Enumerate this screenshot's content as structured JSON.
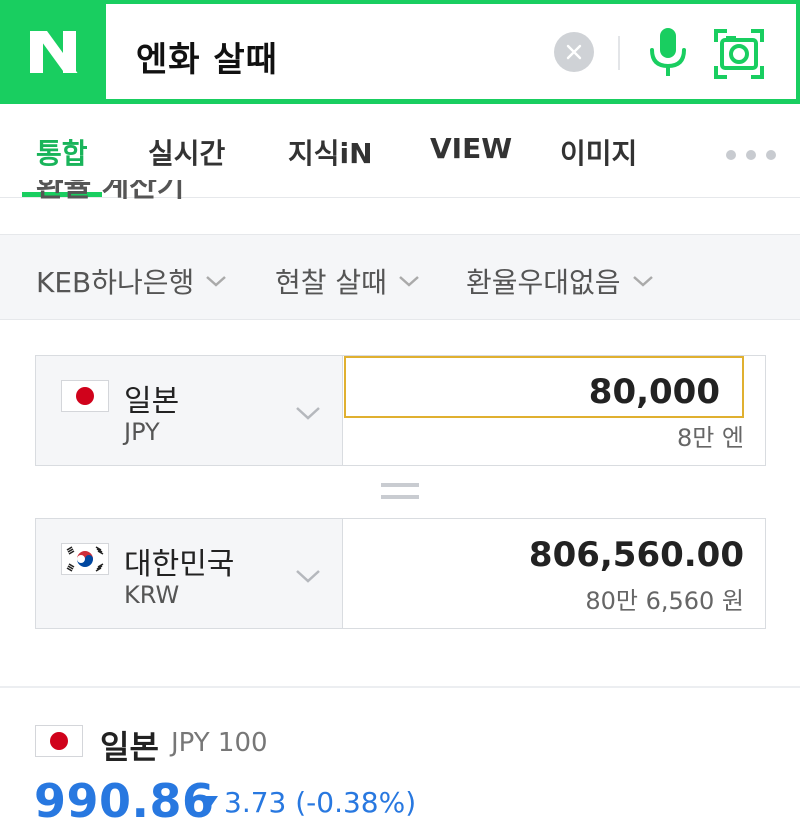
{
  "header": {
    "logo_letter": "N",
    "search_query": "엔화 살때"
  },
  "tabs": [
    {
      "label": "통합",
      "active": true
    },
    {
      "label": "실시간",
      "active": false
    },
    {
      "label": "지식iN",
      "active": false
    },
    {
      "label": "VIEW",
      "active": false
    },
    {
      "label": "이미지",
      "active": false
    }
  ],
  "partially_hidden_heading": "환율 계산기",
  "filters": {
    "bank": "KEB하나은행",
    "rate_type": "현찰 살때",
    "preference": "환율우대없음"
  },
  "converter": {
    "from": {
      "country": "일본",
      "code": "JPY",
      "amount": "80,000",
      "amount_words": "8만 엔"
    },
    "to": {
      "country": "대한민국",
      "code": "KRW",
      "amount": "806,560.00",
      "amount_words": "80만 6,560 원"
    }
  },
  "rate": {
    "country": "일본",
    "unit": "JPY 100",
    "value": "990.86",
    "change": "3.73 (-0.38%)",
    "direction": "down"
  },
  "colors": {
    "brand_green": "#19ce60",
    "rate_blue": "#2878e0",
    "input_focus": "#e0b030"
  },
  "icons": {
    "clear": "close-icon",
    "voice": "microphone-icon",
    "lens": "camera-lens-icon",
    "more": "more-dots-icon"
  }
}
